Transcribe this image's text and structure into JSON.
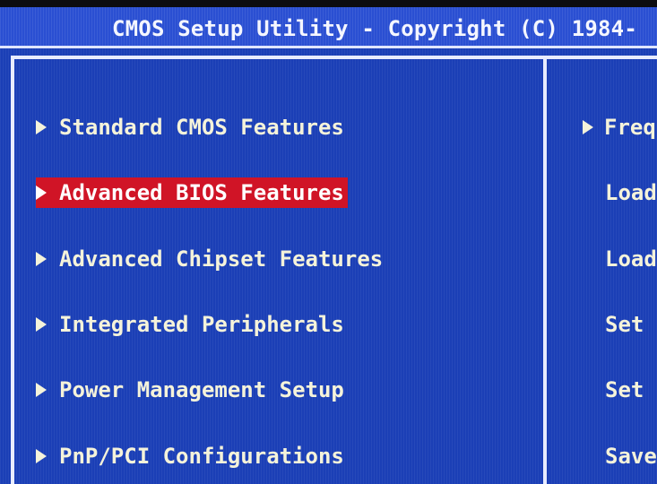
{
  "title": "CMOS Setup Utility - Copyright (C) 1984-",
  "left_menu": [
    {
      "label": "Standard CMOS Features",
      "selected": false
    },
    {
      "label": "Advanced BIOS Features",
      "selected": true
    },
    {
      "label": "Advanced Chipset Features",
      "selected": false
    },
    {
      "label": "Integrated Peripherals",
      "selected": false
    },
    {
      "label": "Power Management Setup",
      "selected": false
    },
    {
      "label": "PnP/PCI Configurations",
      "selected": false
    }
  ],
  "right_menu": [
    {
      "label": "Freq",
      "has_arrow": true
    },
    {
      "label": "Load",
      "has_arrow": false
    },
    {
      "label": "Load",
      "has_arrow": false
    },
    {
      "label": "Set",
      "has_arrow": false
    },
    {
      "label": "Set",
      "has_arrow": false
    },
    {
      "label": "Save",
      "has_arrow": false
    }
  ],
  "colors": {
    "background": "#1b3fb6",
    "text": "#f5f3da",
    "highlight": "#d01426",
    "frame": "#e8ecff"
  }
}
